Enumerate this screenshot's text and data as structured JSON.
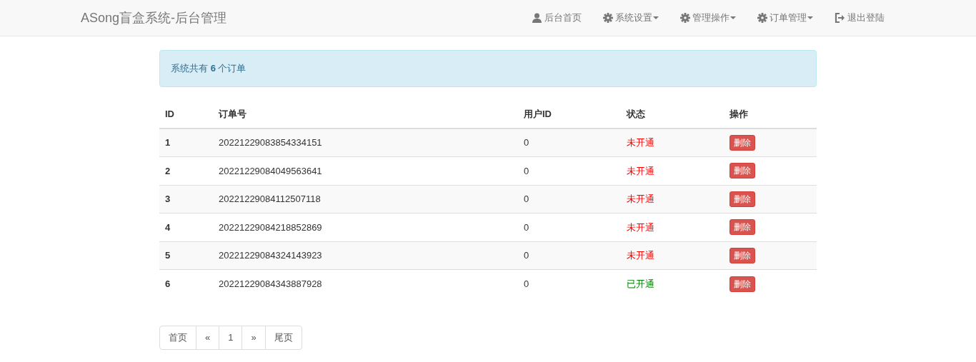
{
  "navbar": {
    "brand": "ASong盲盒系统-后台管理",
    "items": [
      {
        "kind": "home",
        "label": "后台首页",
        "dropdown": false
      },
      {
        "kind": "settings",
        "label": "系统设置",
        "dropdown": true
      },
      {
        "kind": "settings",
        "label": "管理操作",
        "dropdown": true
      },
      {
        "kind": "settings",
        "label": "订单管理",
        "dropdown": true
      },
      {
        "kind": "logout",
        "label": "退出登陆",
        "dropdown": false
      }
    ]
  },
  "alert": "系统共有 **6** 个订单",
  "table": {
    "columns": [
      "ID",
      "订单号",
      "用户ID",
      "状态",
      "操作"
    ],
    "rows": [
      {
        "id": "1",
        "order_no": "20221229083854334151",
        "user_id": "0",
        "status": "未开通",
        "active": false,
        "action": "删除"
      },
      {
        "id": "2",
        "order_no": "20221229084049563641",
        "user_id": "0",
        "status": "未开通",
        "active": false,
        "action": "删除"
      },
      {
        "id": "3",
        "order_no": "20221229084112507118",
        "user_id": "0",
        "status": "未开通",
        "active": false,
        "action": "删除"
      },
      {
        "id": "4",
        "order_no": "20221229084218852869",
        "user_id": "0",
        "status": "未开通",
        "active": false,
        "action": "删除"
      },
      {
        "id": "5",
        "order_no": "20221229084324143923",
        "user_id": "0",
        "status": "未开通",
        "active": false,
        "action": "删除"
      },
      {
        "id": "6",
        "order_no": "20221229084343887928",
        "user_id": "0",
        "status": "已开通",
        "active": true,
        "action": "删除"
      }
    ]
  },
  "pagination": [
    "首页",
    "«",
    "1",
    "»",
    "尾页"
  ]
}
